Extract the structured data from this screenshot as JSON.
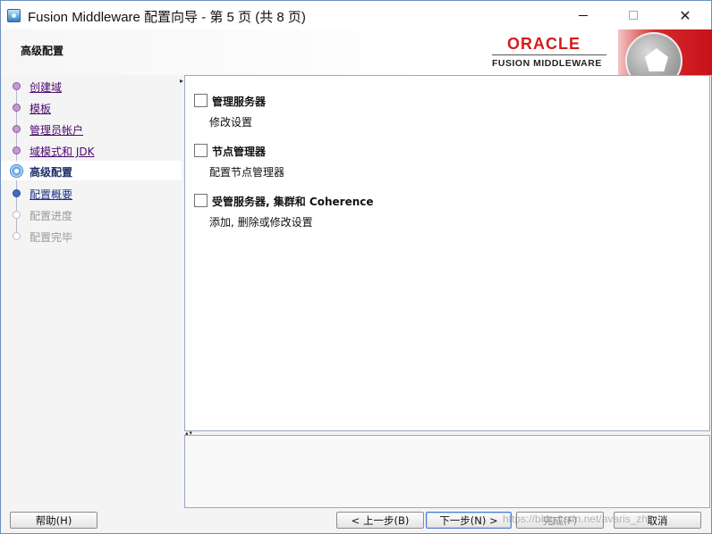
{
  "window": {
    "title": "Fusion Middleware 配置向导 - 第 5 页 (共 8 页)",
    "minimize_glyph": "—",
    "maximize_glyph": "☐",
    "close_glyph": "✕"
  },
  "header": {
    "page_title": "高级配置",
    "oracle_logo": "ORACLE",
    "product_line": "FUSION MIDDLEWARE"
  },
  "steps": [
    {
      "label": "创建域",
      "state": "done"
    },
    {
      "label": "模板",
      "state": "done"
    },
    {
      "label": "管理员帐户",
      "state": "done"
    },
    {
      "label": "域模式和 JDK",
      "state": "done"
    },
    {
      "label": "高级配置",
      "state": "current"
    },
    {
      "label": "配置概要",
      "state": "next"
    },
    {
      "label": "配置进度",
      "state": "pending"
    },
    {
      "label": "配置完毕",
      "state": "pending"
    }
  ],
  "options": [
    {
      "label": "管理服务器",
      "description": "修改设置",
      "checked": false
    },
    {
      "label": "节点管理器",
      "description": "配置节点管理器",
      "checked": false
    },
    {
      "label": "受管服务器, 集群和 Coherence",
      "description": "添加, 删除或修改设置",
      "checked": false
    }
  ],
  "buttons": {
    "help": "帮助(H)",
    "back": "< 上一步(B)",
    "next": "下一步(N) >",
    "finish": "完成(F)",
    "cancel": "取消"
  },
  "watermark": "https://blog.csdn.net/avaris_zh"
}
